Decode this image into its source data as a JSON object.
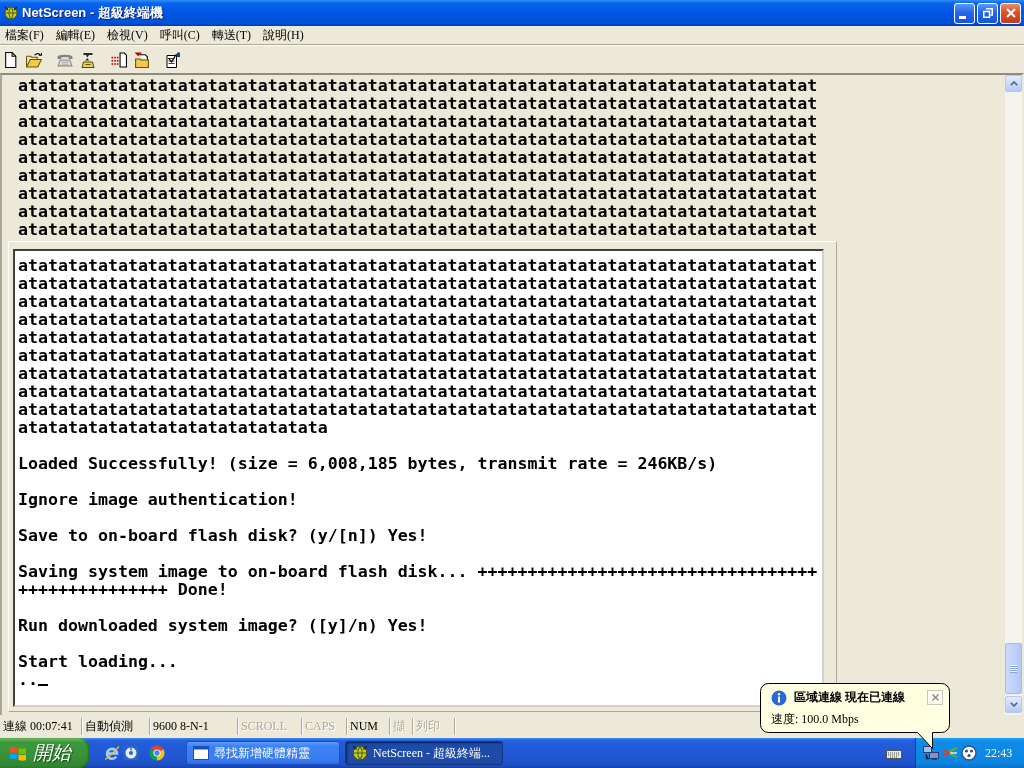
{
  "window": {
    "title": "NetScreen - 超級終端機"
  },
  "menu_bar": [
    "檔案(F)",
    "編輯(E)",
    "檢視(V)",
    "呼叫(C)",
    "轉送(T)",
    "說明(H)"
  ],
  "toolbar": [
    [
      {
        "kind": "new",
        "disabled": false
      },
      {
        "kind": "open",
        "disabled": false
      }
    ],
    [
      {
        "kind": "call",
        "disabled": true
      },
      {
        "kind": "hang_up",
        "disabled": false
      }
    ],
    [
      {
        "kind": "send",
        "disabled": false
      },
      {
        "kind": "receive",
        "disabled": false
      }
    ],
    [
      {
        "kind": "properties",
        "disabled": false
      }
    ]
  ],
  "terminal": {
    "scrollback": [
      "atatatatatatatatatatatatatatatatatatatatatatatatatatatatatatatatatatatatatatatat",
      "atatatatatatatatatatatatatatatatatatatatatatatatatatatatatatatatatatatatatatatat",
      "atatatatatatatatatatatatatatatatatatatatatatatatatatatatatatatatatatatatatatatat",
      "atatatatatatatatatatatatatatatatatatatatatatatatatatatatatatatatatatatatatatatat",
      "atatatatatatatatatatatatatatatatatatatatatatatatatatatatatatatatatatatatatatatat",
      "atatatatatatatatatatatatatatatatatatatatatatatatatatatatatatatatatatatatatatatat",
      "atatatatatatatatatatatatatatatatatatatatatatatatatatatatatatatatatatatatatatatat",
      "atatatatatatatatatatatatatatatatatatatatatatatatatatatatatatatatatatatatatatatat",
      "atatatatatatatatatatatatatatatatatatatatatatatatatatatatatatatatatatatatatatatat"
    ],
    "screen": [
      [
        "atatatatatatatatatatatatatatatatatatatatatatatatatatatatatatatatatatatatatatatat",
        "atatatatatatatatatatatatatatatatatatatatatatatatatatatatatatatatatatatatatatatat",
        "atatatatatatatatatatatatatatatatatatatatatatatatatatatatatatatatatatatatatatatat",
        "atatatatatatatatatatatatatatatatatatatatatatatatatatatatatatatatatatatatatatatat",
        "atatatatatatatatatatatatatatatatatatatatatatatatatatatatatatatatatatatatatatatat",
        "atatatatatatatatatatatatatatatatatatatatatatatatatatatatatatatatatatatatatatatat",
        "atatatatatatatatatatatatatatatatatatatatatatatatatatatatatatatatatatatatatatatat",
        "atatatatatatatatatatatatatatatatatatatatatatatatatatatatatatatatatatatatatatatat",
        "atatatatatatatatatatatatatatatatatatatatatatatatatatatatatatatatatatatatatatatat",
        "atatatatatatatatatatatatatatata"
      ],
      [
        "Loaded Successfully! (size = 6,008,185 bytes, transmit rate = 246KB/s)"
      ],
      [
        "Ignore image authentication!"
      ],
      [
        "Save to on-board flash disk? (y/[n]) Yes!"
      ],
      [
        "Saving system image to on-board flash disk... ++++++++++++++++++++++++++++++++++",
        "+++++++++++++++ Done!"
      ],
      [
        "Run downloaded system image? ([y]/n) Yes!"
      ],
      [
        "Start loading...",
        ".."
      ]
    ]
  },
  "status_bar": {
    "fields": [
      "連線 00:07:41",
      "自動偵測",
      "9600 8-N-1"
    ],
    "indicators": [
      {
        "label": "SCROLL",
        "active": false
      },
      {
        "label": "CAPS",
        "active": false
      },
      {
        "label": "NUM",
        "active": true
      },
      {
        "label": "擷",
        "active": false
      },
      {
        "label": "列印",
        "active": false
      }
    ]
  },
  "taskbar": {
    "start_button": "開始",
    "tasks": [
      {
        "label": "尋找新增硬體精靈",
        "kind": "window",
        "selected": false
      },
      {
        "label": "NetScreen - 超級終端...",
        "kind": "app",
        "selected": true
      }
    ],
    "clock": "22:43"
  },
  "notification": {
    "title": "區域連線 現在已連線",
    "text": "速度: 100.0 Mbps"
  }
}
